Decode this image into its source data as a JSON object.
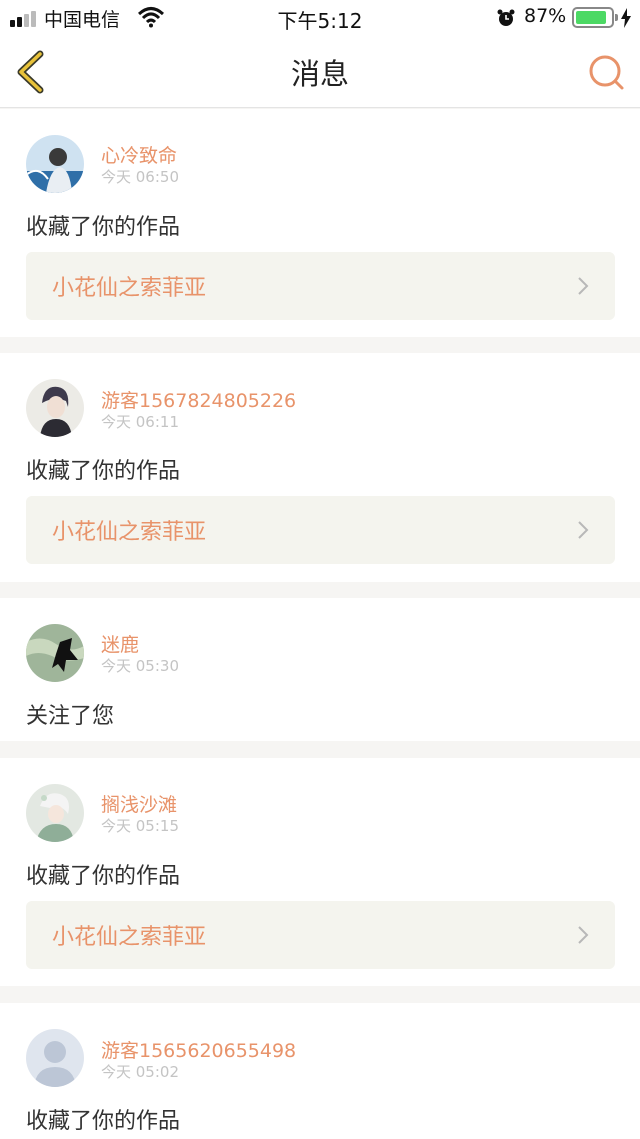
{
  "status_bar": {
    "carrier": "中国电信",
    "time": "下午5:12",
    "battery_percent": "87%",
    "battery_level": 0.87
  },
  "nav": {
    "title": "消息",
    "back_icon": "chevron-left-icon",
    "search_icon": "search-icon"
  },
  "colors": {
    "accent": "#e8936a",
    "back_icon": "#e8c23a",
    "timestamp": "#c4c4c4",
    "work_card_bg": "#f4f4ee",
    "page_bg": "#f6f5f3"
  },
  "messages": [
    {
      "user": "心冷致命",
      "time": "今天 06:50",
      "action": "收藏了你的作品",
      "work_title": "小花仙之索菲亚"
    },
    {
      "user": "游客1567824805226",
      "time": "今天 06:11",
      "action": "收藏了你的作品",
      "work_title": "小花仙之索菲亚"
    },
    {
      "user": "迷鹿",
      "time": "今天 05:30",
      "action": "关注了您"
    },
    {
      "user": "搁浅沙滩",
      "time": "今天 05:15",
      "action": "收藏了你的作品",
      "work_title": "小花仙之索菲亚"
    },
    {
      "user": "游客1565620655498",
      "time": "今天 05:02",
      "action": "收藏了你的作品"
    }
  ]
}
